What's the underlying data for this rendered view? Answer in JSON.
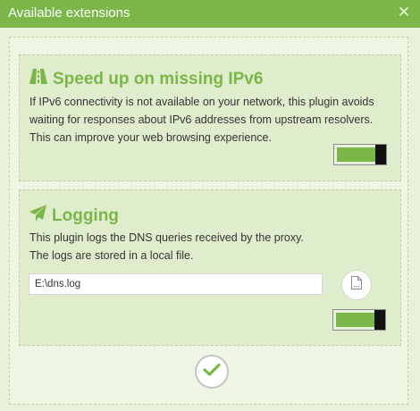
{
  "window": {
    "title": "Available extensions",
    "close_icon": "close-icon",
    "accent_color": "#7ab648"
  },
  "extensions": [
    {
      "icon": "road-icon",
      "title": "Speed up on missing IPv6",
      "description": "If IPv6 connectivity is not available on your network, this plugin avoids waiting for responses about IPv6 addresses from upstream resolvers. This can improve your web browsing experience.",
      "enabled": true
    },
    {
      "icon": "paper-plane-icon",
      "title": "Logging",
      "description_lines": [
        "This plugin logs the DNS queries received by the proxy.",
        "The logs are stored in a local file."
      ],
      "log_path": "E:\\dns.log",
      "file_button_icon": "file-icon",
      "enabled": true
    }
  ],
  "footer": {
    "ok_icon": "checkmark-icon"
  }
}
